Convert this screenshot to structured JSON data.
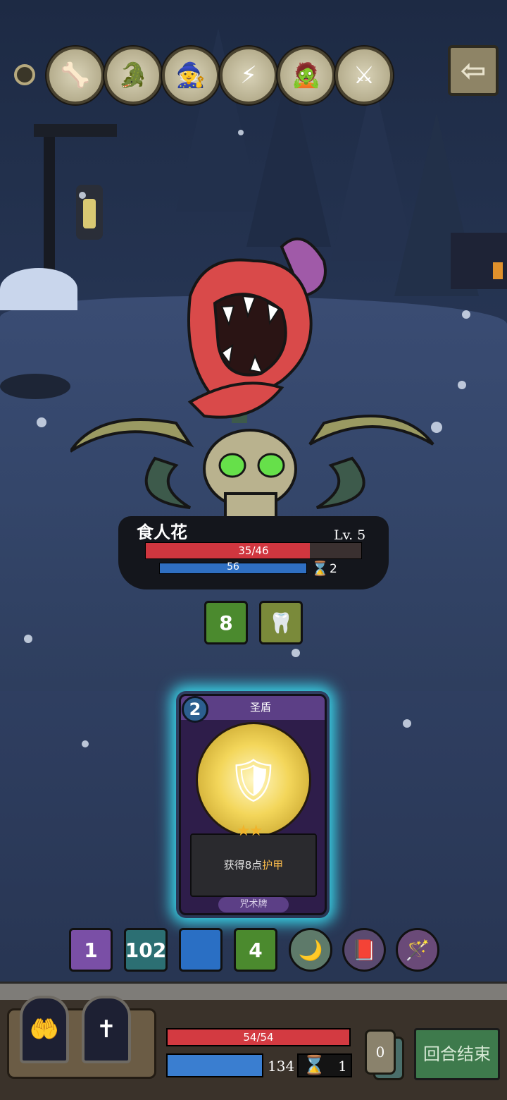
{
  "enemy_queue": [
    {
      "name": "enemy-portrait-1",
      "icon": "🦴"
    },
    {
      "name": "enemy-portrait-2",
      "icon": "🐊"
    },
    {
      "name": "enemy-portrait-3",
      "icon": "🧙"
    },
    {
      "name": "enemy-portrait-4",
      "icon": "⚡"
    },
    {
      "name": "enemy-portrait-5",
      "icon": "🧟"
    },
    {
      "name": "enemy-portrait-6",
      "icon": "⚔"
    }
  ],
  "back_icon": "⇦",
  "enemy": {
    "name": "食人花",
    "level": "Lv. 5",
    "hp_text": "35/46",
    "hp_fraction": 0.76,
    "mp_text": "56",
    "mp_fraction": 1.0,
    "turn_counter": "2",
    "hourglass_icon": "⌛"
  },
  "enemy_intents": [
    {
      "label": "8",
      "icon": "heal-plus-icon",
      "color": "#4b8a2e"
    },
    {
      "label": "🦷",
      "icon": "bite-icon",
      "color": "#7a8a3a"
    }
  ],
  "card": {
    "cost": "2",
    "name": "圣盾",
    "art_icon": "🛡",
    "stars": "★★",
    "desc_prefix": "获得8点",
    "desc_highlight": "护甲",
    "type": "咒术牌"
  },
  "player_buffs": [
    {
      "label": "1",
      "color": "#7a4fa6",
      "icon": "rune-icon"
    },
    {
      "label": "102",
      "color": "#2c6f73",
      "icon": "energy-icon"
    },
    {
      "label": "",
      "color": "#2a6fc4",
      "icon": "slash-icon"
    },
    {
      "label": "4",
      "color": "#4b8a2e",
      "icon": "heal-plus-icon"
    },
    {
      "label": "🌙",
      "color": "#5e7a6a",
      "icon": "moon-icon"
    },
    {
      "label": "📕",
      "color": "#5a4a70",
      "icon": "book-icon"
    },
    {
      "label": "🪄",
      "color": "#6a4a78",
      "icon": "staff-icon"
    }
  ],
  "skills": [
    {
      "icon": "🤲",
      "name": "magic-hand-skill"
    },
    {
      "icon": "✝",
      "name": "cross-skill"
    }
  ],
  "player": {
    "hp_text": "54/54",
    "hp_fraction": 1.0,
    "mp_fraction": 1.0,
    "energy": "134",
    "turn": "1",
    "hourglass_icon": "⌛"
  },
  "deck_count": "0",
  "end_turn_label": "回合结束"
}
